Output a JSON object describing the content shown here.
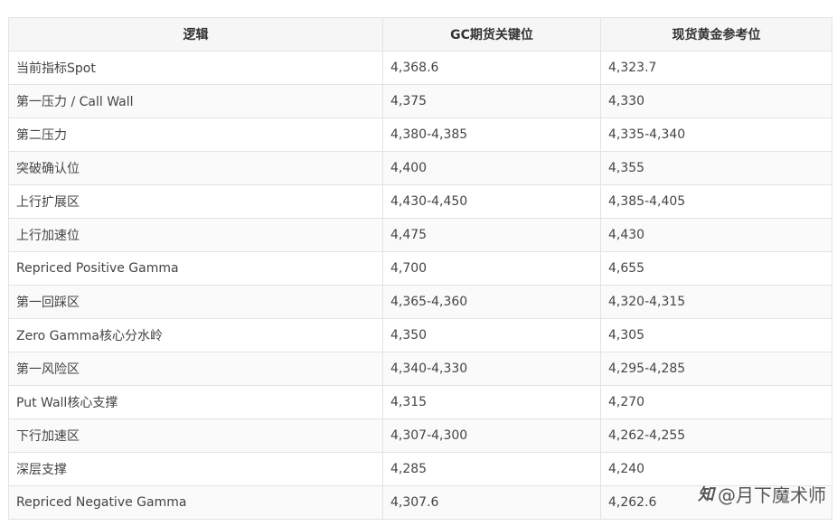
{
  "table": {
    "headers": [
      "逻辑",
      "GC期货关键位",
      "现货黄金参考位"
    ],
    "rows": [
      [
        "当前指标Spot",
        "4,368.6",
        "4,323.7"
      ],
      [
        "第一压力 / Call Wall",
        "4,375",
        "4,330"
      ],
      [
        "第二压力",
        "4,380-4,385",
        "4,335-4,340"
      ],
      [
        "突破确认位",
        "4,400",
        "4,355"
      ],
      [
        "上行扩展区",
        "4,430-4,450",
        "4,385-4,405"
      ],
      [
        "上行加速位",
        "4,475",
        "4,430"
      ],
      [
        "Repriced Positive Gamma",
        "4,700",
        "4,655"
      ],
      [
        "第一回踩区",
        "4,365-4,360",
        "4,320-4,315"
      ],
      [
        "Zero Gamma核心分水岭",
        "4,350",
        "4,305"
      ],
      [
        "第一风险区",
        "4,340-4,330",
        "4,295-4,285"
      ],
      [
        "Put Wall核心支撑",
        "4,315",
        "4,270"
      ],
      [
        "下行加速区",
        "4,307-4,300",
        "4,262-4,255"
      ],
      [
        "深层支撑",
        "4,285",
        "4,240"
      ],
      [
        "Repriced Negative Gamma",
        "4,307.6",
        "4,262.6"
      ]
    ]
  },
  "watermark": {
    "logo": "知",
    "text": "@月下魔术师"
  }
}
